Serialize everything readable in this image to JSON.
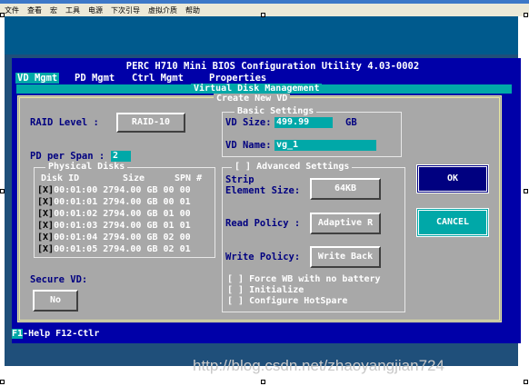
{
  "window": {
    "menu": [
      "文件",
      "查看",
      "宏",
      "工具",
      "电源",
      "下次引导",
      "虚拟介质",
      "帮助"
    ]
  },
  "bios": {
    "heading": "PERC H710 Mini BIOS Configuration Utility 4.03-0002",
    "tabs": [
      "VD Mgmt",
      "PD Mgmt",
      "Ctrl Mgmt",
      "Properties"
    ],
    "active_tab": "VD Mgmt",
    "section_title": "Virtual Disk Management",
    "dialog_title": "Create New VD"
  },
  "form": {
    "raid_level_label": "RAID Level :",
    "raid_level_value": "RAID-10",
    "pd_per_span_label": "PD per Span :",
    "pd_per_span_value": "2",
    "physical_disks_title": "Physical Disks",
    "disk_headers": [
      "Disk ID",
      "Size",
      "SPN #"
    ],
    "disks": [
      {
        "check": "[X]",
        "id": "00:01:00",
        "size": "2794.00 GB",
        "spn": "00 00"
      },
      {
        "check": "[X]",
        "id": "00:01:01",
        "size": "2794.00 GB",
        "spn": "00 01"
      },
      {
        "check": "[X]",
        "id": "00:01:02",
        "size": "2794.00 GB",
        "spn": "01 00"
      },
      {
        "check": "[X]",
        "id": "00:01:03",
        "size": "2794.00 GB",
        "spn": "01 01"
      },
      {
        "check": "[X]",
        "id": "00:01:04",
        "size": "2794.00 GB",
        "spn": "02 00"
      },
      {
        "check": "[X]",
        "id": "00:01:05",
        "size": "2794.00 GB",
        "spn": "02 01"
      }
    ],
    "secure_vd_label": "Secure VD:",
    "secure_vd_value": "No",
    "basic_settings_title": "Basic Settings",
    "vd_size_label": "VD Size:",
    "vd_size_value": "499.99",
    "vd_size_unit": "GB",
    "vd_name_label": "VD Name:",
    "vd_name_value": "vg_1",
    "advanced_title": "[ ] Advanced Settings",
    "strip_label": "Strip",
    "element_size_label": "Element Size:",
    "element_size_value": "64KB",
    "read_policy_label": "Read Policy :",
    "read_policy_value": "Adaptive R",
    "write_policy_label": "Write Policy:",
    "write_policy_value": "Write Back",
    "options": [
      "[ ] Force WB with no battery",
      "[ ] Initialize",
      "[ ] Configure HotSpare"
    ],
    "ok_label": "OK",
    "cancel_label": "CANCEL"
  },
  "help": {
    "f1_key": "F1",
    "f1_text": "-Help F12-Ctlr"
  },
  "watermark": "http://blog.csdn.net/zhaoyangjian724",
  "colors": {
    "bios_blue": "#0000a8",
    "bios_cyan": "#00a8a8",
    "dialog_gray": "#a8a8a8"
  }
}
